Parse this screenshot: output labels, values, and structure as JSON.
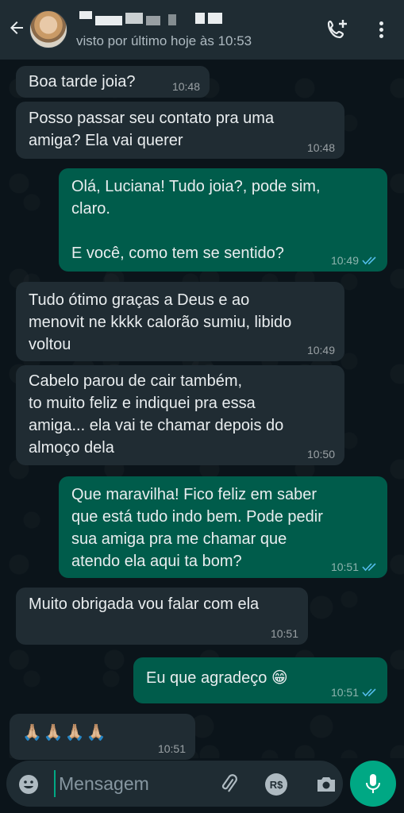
{
  "header": {
    "contact_name": "",
    "last_seen": "visto por último hoje às 10:53"
  },
  "messages": [
    {
      "dir": "in",
      "text": "Boa tarde joia?",
      "time": "10:48"
    },
    {
      "dir": "in",
      "text": "Posso passar seu contato pra uma\namiga? Ela vai querer",
      "time": "10:48"
    },
    {
      "dir": "out",
      "text": "Olá, Luciana! Tudo joia?, pode sim,\nclaro.\n\nE você, como tem se sentido?",
      "time": "10:49",
      "read": true
    },
    {
      "dir": "in",
      "text": "Tudo ótimo graças a Deus e ao\nmenovit ne kkkk calorão sumiu, libido\nvoltou",
      "time": "10:49"
    },
    {
      "dir": "in",
      "text": "Cabelo parou de cair também,\nto muito feliz e indiquei pra essa\namiga... ela vai te chamar depois do\nalmoço dela",
      "time": "10:50"
    },
    {
      "dir": "out",
      "text": "Que maravilha! Fico feliz em saber\nque está tudo indo bem. Pode pedir\nsua amiga pra me chamar que\natendo ela aqui ta bom?",
      "time": "10:51",
      "read": true
    },
    {
      "dir": "in",
      "text": "Muito obrigada vou falar com ela",
      "time": "10:51"
    },
    {
      "dir": "out",
      "text": "Eu que agradeço 😁",
      "time": "10:51",
      "read": true
    },
    {
      "dir": "in",
      "text": "🙏🏼🙏🏼🙏🏼🙏🏼",
      "time": "10:51"
    }
  ],
  "composer": {
    "placeholder": "Mensagem",
    "payment_label": "R$"
  },
  "colors": {
    "incoming": "#202c33",
    "outgoing": "#005c4b",
    "read_check": "#53bdeb",
    "accent": "#00a884"
  }
}
